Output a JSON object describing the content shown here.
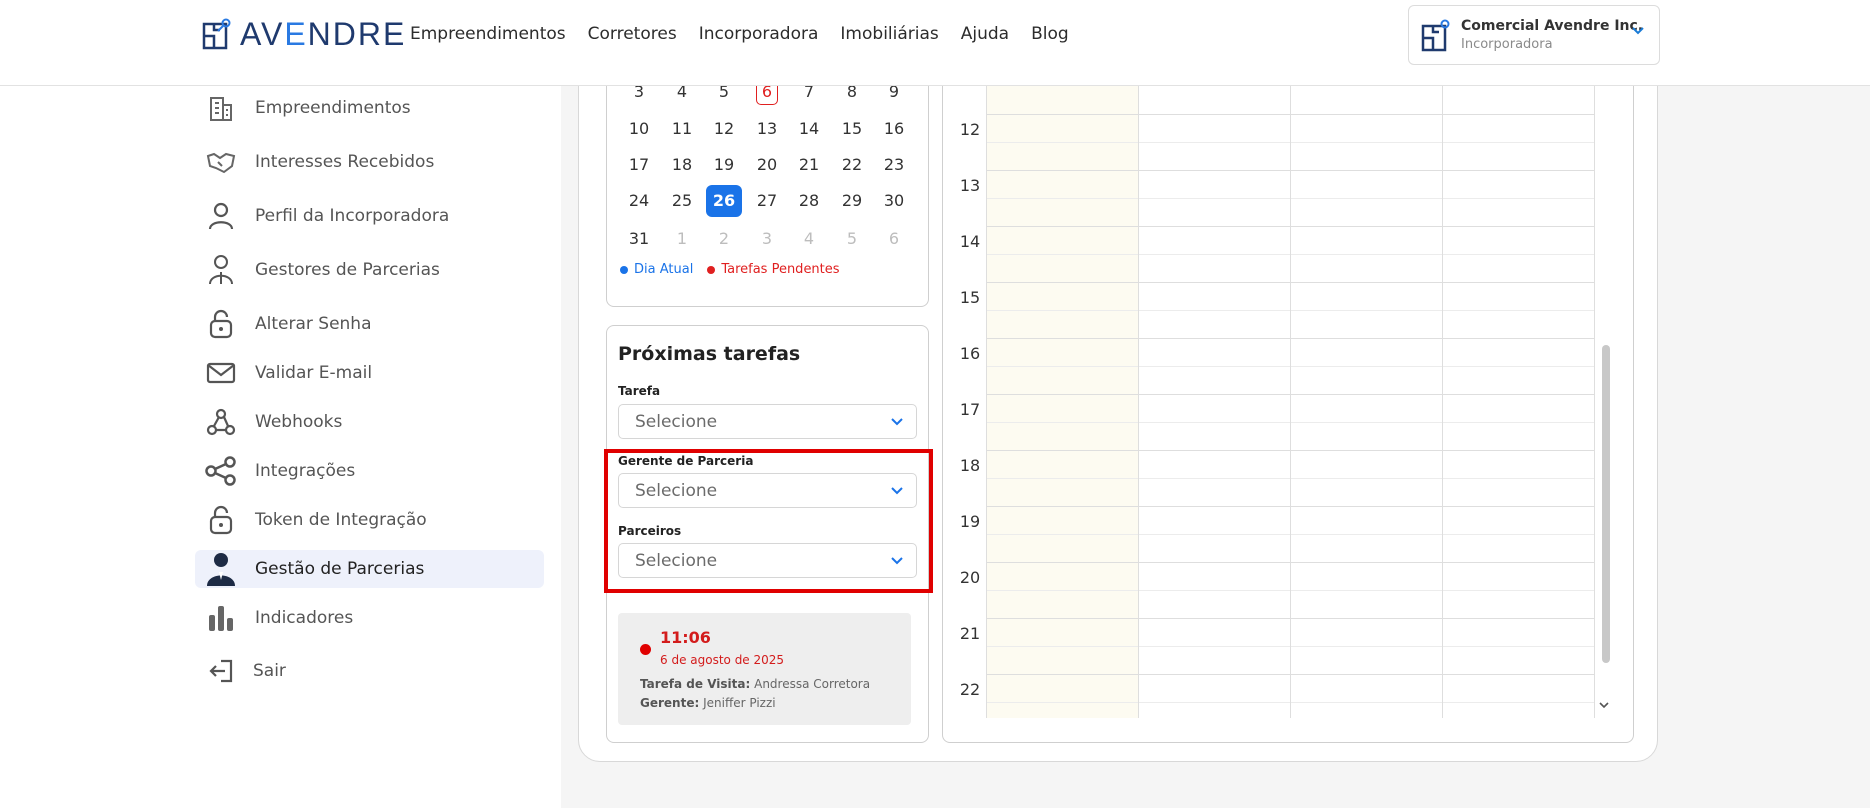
{
  "header": {
    "logo_text_a": "AV",
    "logo_text_b": "E",
    "logo_text_c": "NDRE",
    "nav": [
      "Empreendimentos",
      "Corretores",
      "Incorporadora",
      "Imobiliárias",
      "Ajuda",
      "Blog"
    ],
    "account_name": "Comercial Avendre Inc.",
    "account_role": "Incorporadora"
  },
  "sidebar": {
    "items": [
      {
        "label": "Empreendimentos",
        "icon": "building-icon"
      },
      {
        "label": "Interesses Recebidos",
        "icon": "handshake-icon"
      },
      {
        "label": "Perfil da Incorporadora",
        "icon": "user-icon"
      },
      {
        "label": "Gestores de Parcerias",
        "icon": "user-manager-icon"
      },
      {
        "label": "Alterar Senha",
        "icon": "unlock-icon"
      },
      {
        "label": "Validar E-mail",
        "icon": "mail-icon"
      },
      {
        "label": "Webhooks",
        "icon": "webhook-icon"
      },
      {
        "label": "Integrações",
        "icon": "share-icon"
      },
      {
        "label": "Token de Integração",
        "icon": "unlock-icon"
      },
      {
        "label": "Gestão de Parcerias",
        "icon": "business-person-icon"
      },
      {
        "label": "Indicadores",
        "icon": "bar-chart-icon"
      },
      {
        "label": "Sair",
        "icon": "logout-icon"
      }
    ],
    "active_index": 9
  },
  "calendar": {
    "rows": [
      [
        "3",
        "4",
        "5",
        "6",
        "7",
        "8",
        "9"
      ],
      [
        "10",
        "11",
        "12",
        "13",
        "14",
        "15",
        "16"
      ],
      [
        "17",
        "18",
        "19",
        "20",
        "21",
        "22",
        "23"
      ],
      [
        "24",
        "25",
        "26",
        "27",
        "28",
        "29",
        "30"
      ],
      [
        "31",
        "1",
        "2",
        "3",
        "4",
        "5",
        "6"
      ]
    ],
    "today": "26",
    "pending": "6",
    "legend_today": "Dia Atual",
    "legend_pending": "Tarefas Pendentes"
  },
  "tasks": {
    "title": "Próximas tarefas",
    "field_tarefa_label": "Tarefa",
    "field_tarefa_placeholder": "Selecione",
    "field_gerente_label": "Gerente de Parceria",
    "field_gerente_placeholder": "Selecione",
    "field_parceiros_label": "Parceiros",
    "field_parceiros_placeholder": "Selecione",
    "item": {
      "time": "11:06",
      "date": "6 de agosto de 2025",
      "type_label": "Tarefa de Visita:",
      "type_value": "Andressa Corretora",
      "manager_label": "Gerente:",
      "manager_value": "Jeniffer Pizzi"
    }
  },
  "schedule": {
    "hours": [
      "12",
      "13",
      "14",
      "15",
      "16",
      "17",
      "18",
      "19",
      "20",
      "21",
      "22"
    ]
  },
  "colors": {
    "primary": "#1a73e8",
    "pending": "#e02020",
    "highlight": "#e00000",
    "brand_dark": "#1f3a6e"
  }
}
